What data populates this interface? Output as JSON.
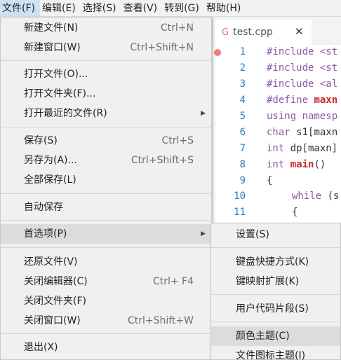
{
  "menubar": {
    "items": [
      "文件(F)",
      "编辑(E)",
      "选择(S)",
      "查看(V)",
      "转到(G)",
      "帮助(H)"
    ]
  },
  "editor": {
    "tab": {
      "filename": "test.cpp",
      "close": "✕"
    },
    "line_numbers": [
      "1",
      "2",
      "3",
      "4",
      "5",
      "6",
      "7",
      "8",
      "9",
      "10",
      "11"
    ],
    "code": {
      "l1": "#include <st",
      "l2": "#include <st",
      "l3": "#include <al",
      "l4a": "#define ",
      "l4b": "maxn",
      "l5a": "using ",
      "l5b": "namesp",
      "l6a": "char ",
      "l6b": "s1[maxn",
      "l7a": "int ",
      "l7b": "dp[maxn]",
      "l8a": "int ",
      "l8b": "main",
      "l8c": "()",
      "l9": "{",
      "l10a": "while ",
      "l10b": "(s",
      "l11": "{"
    }
  },
  "file_menu": {
    "new_file": {
      "label": "新建文件(N)",
      "shortcut": "Ctrl+N"
    },
    "new_window": {
      "label": "新建窗口(W)",
      "shortcut": "Ctrl+Shift+N"
    },
    "open_file": {
      "label": "打开文件(O)..."
    },
    "open_folder": {
      "label": "打开文件夹(F)..."
    },
    "open_recent": {
      "label": "打开最近的文件(R)"
    },
    "save": {
      "label": "保存(S)",
      "shortcut": "Ctrl+S"
    },
    "save_as": {
      "label": "另存为(A)...",
      "shortcut": "Ctrl+Shift+S"
    },
    "save_all": {
      "label": "全部保存(L)"
    },
    "auto_save": {
      "label": "自动保存"
    },
    "preferences": {
      "label": "首选项(P)"
    },
    "revert_file": {
      "label": "还原文件(V)"
    },
    "close_editor": {
      "label": "关闭编辑器(C)",
      "shortcut": "Ctrl+ F4"
    },
    "close_folder": {
      "label": "关闭文件夹(F)"
    },
    "close_window": {
      "label": "关闭窗口(W)",
      "shortcut": "Ctrl+Shift+W"
    },
    "exit": {
      "label": "退出(X)"
    }
  },
  "preferences_menu": {
    "settings": "设置(S)",
    "keyboard_shortcuts": "键盘快捷方式(K)",
    "keymap_extensions": "键映射扩展(K)",
    "user_snippets": "用户代码片段(S)",
    "color_theme": "颜色主题(C)",
    "file_icon_theme": "文件图标主题(I)"
  },
  "colors": {
    "line_number": "#2a7fb6",
    "keyword": "#8959a8",
    "highlight": "#dcdcdc",
    "menu_bg": "#f0f0f0"
  }
}
